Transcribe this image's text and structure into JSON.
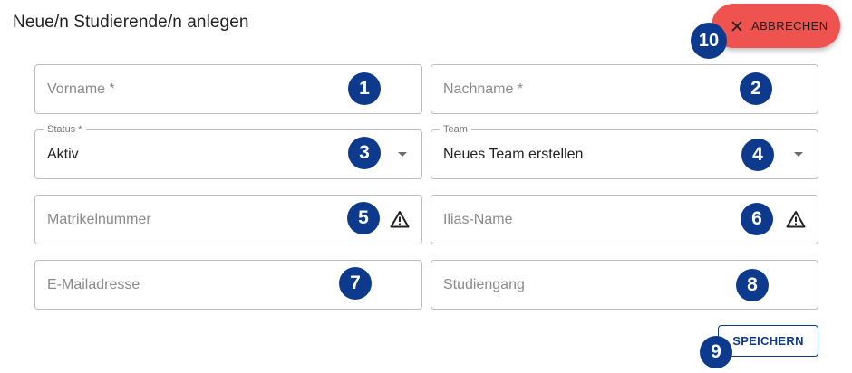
{
  "dialog": {
    "title": "Neue/n Studierende/n anlegen"
  },
  "actions": {
    "cancel_label": "ABBRECHEN",
    "save_label": "SPEICHERN"
  },
  "fields": {
    "vorname": {
      "placeholder": "Vorname *"
    },
    "nachname": {
      "placeholder": "Nachname *"
    },
    "status": {
      "label": "Status *",
      "value": "Aktiv"
    },
    "team": {
      "label": "Team",
      "value": "Neues Team erstellen"
    },
    "matrikelnummer": {
      "placeholder": "Matrikelnummer"
    },
    "ilias_name": {
      "placeholder": "Ilias-Name"
    },
    "email": {
      "placeholder": "E-Mailadresse"
    },
    "studiengang": {
      "placeholder": "Studiengang"
    }
  },
  "badges": [
    "1",
    "2",
    "3",
    "4",
    "5",
    "6",
    "7",
    "8",
    "9",
    "10"
  ],
  "icons": {
    "warning": "warning-triangle-icon",
    "dropdown": "caret-down-icon",
    "close": "close-icon"
  },
  "colors": {
    "cancel_bg": "#ef5350",
    "badge_bg": "#0d3a8c",
    "save_text": "#0d3a8c",
    "border": "#bdbdbd"
  }
}
